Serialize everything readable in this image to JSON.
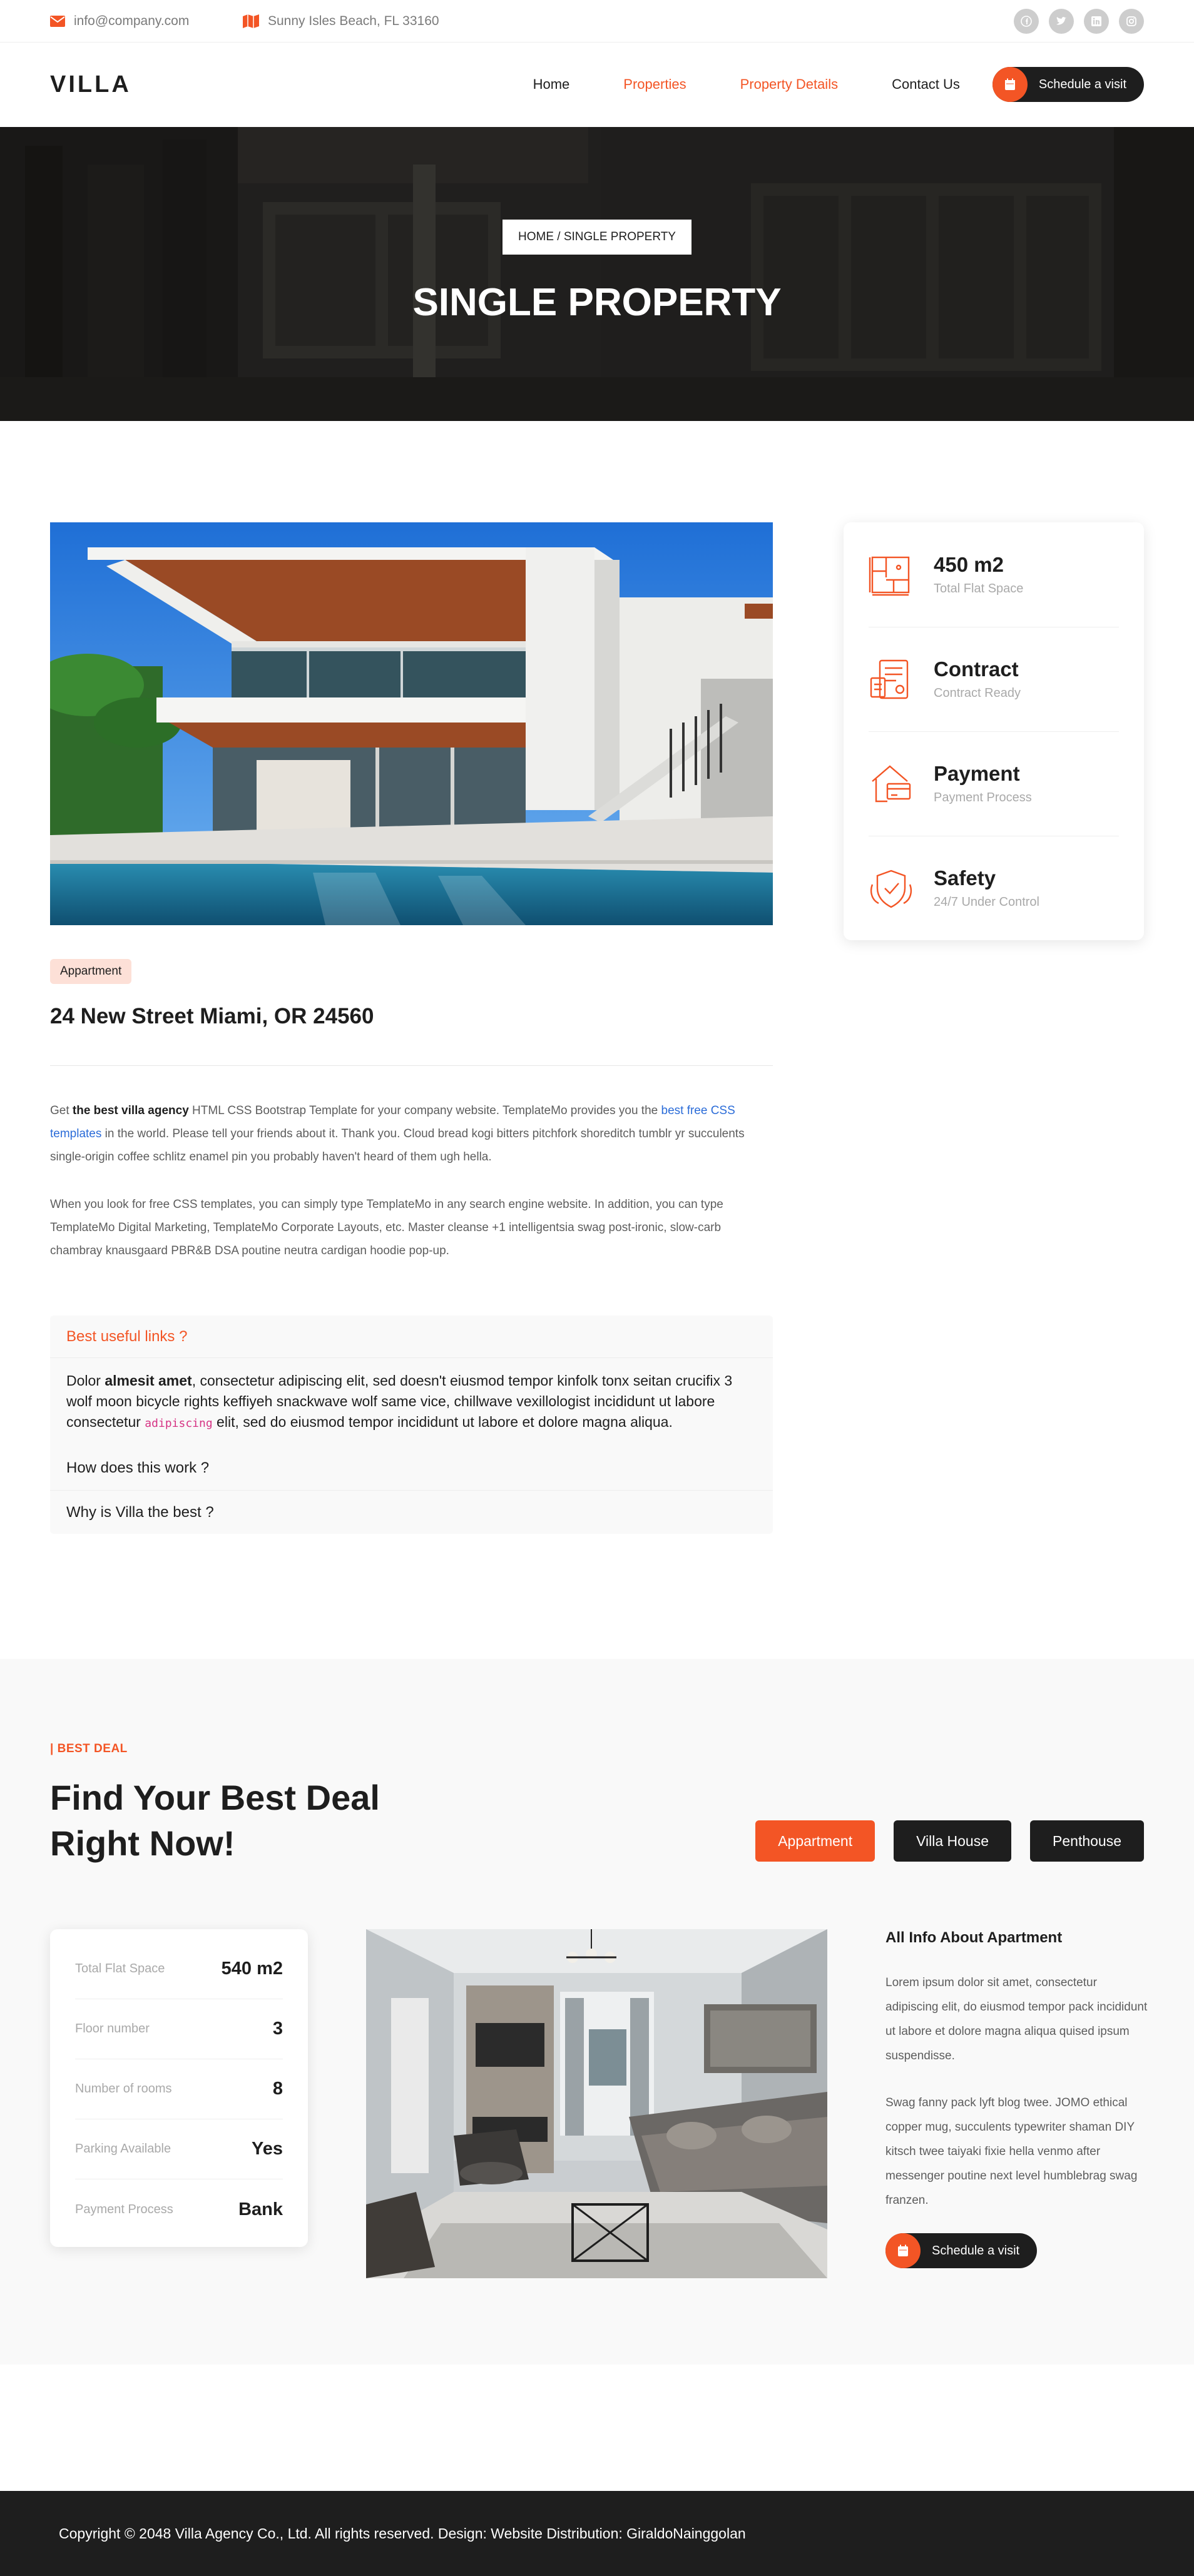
{
  "topbar": {
    "email": "info@company.com",
    "address": "Sunny Isles Beach, FL 33160",
    "socials": [
      "facebook-icon",
      "twitter-icon",
      "linkedin-icon",
      "instagram-icon"
    ]
  },
  "header": {
    "logo": "VILLA",
    "nav": [
      {
        "label": "Home",
        "active": false
      },
      {
        "label": "Properties",
        "active": true
      },
      {
        "label": "Property Details",
        "active": true
      },
      {
        "label": "Contact Us",
        "active": false
      }
    ],
    "cta": "Schedule a visit"
  },
  "hero": {
    "breadcrumb": "HOME / SINGLE PROPERTY",
    "title": "SINGLE PROPERTY"
  },
  "property": {
    "badge": "Appartment",
    "title": "24 New Street Miami, OR 24560",
    "para1": {
      "pre": "Get ",
      "bold": "the best villa agency",
      "mid": " HTML CSS Bootstrap Template for your company website. TemplateMo provides you the ",
      "link": "best free CSS templates",
      "post": " in the world. Please tell your friends about it. Thank you. Cloud bread kogi bitters pitchfork shoreditch tumblr yr succulents single-origin coffee schlitz enamel pin you probably haven't heard of them ugh hella."
    },
    "para2": "When you look for free CSS templates, you can simply type TemplateMo in any search engine website. In addition, you can type TemplateMo Digital Marketing, TemplateMo Corporate Layouts, etc. Master cleanse +1 intelligentsia swag post-ironic, slow-carb chambray knausgaard PBR&B DSA poutine neutra cardigan hoodie pop-up.",
    "accordion": {
      "open_title": "Best useful links ?",
      "body_pre": "Dolor ",
      "body_bold": "almesit amet",
      "body_mid": ", consectetur adipiscing elit, sed doesn't eiusmod tempor kinfolk tonx seitan crucifix 3 wolf moon bicycle rights keffiyeh snackwave wolf same vice, chillwave vexillologist incididunt ut labore consectetur ",
      "body_code": "adipiscing",
      "body_post": " elit, sed do eiusmod tempor incididunt ut labore et dolore magna aliqua.",
      "items": [
        "How does this work ?",
        "Why is Villa the best ?"
      ]
    }
  },
  "info_card": [
    {
      "title": "450 m2",
      "sub": "Total Flat Space"
    },
    {
      "title": "Contract",
      "sub": "Contract Ready"
    },
    {
      "title": "Payment",
      "sub": "Payment Process"
    },
    {
      "title": "Safety",
      "sub": "24/7 Under Control"
    }
  ],
  "deal": {
    "label": "| BEST DEAL",
    "title": "Find Your Best Deal Right Now!",
    "tabs": [
      {
        "label": "Appartment",
        "active": true
      },
      {
        "label": "Villa House",
        "active": false
      },
      {
        "label": "Penthouse",
        "active": false
      }
    ],
    "specs": [
      {
        "key": "Total Flat Space",
        "value": "540 m2"
      },
      {
        "key": "Floor number",
        "value": "3"
      },
      {
        "key": "Number of rooms",
        "value": "8"
      },
      {
        "key": "Parking Available",
        "value": "Yes"
      },
      {
        "key": "Payment Process",
        "value": "Bank"
      }
    ],
    "about_title": "All Info About Apartment",
    "about_p1": "Lorem ipsum dolor sit amet, consectetur adipiscing elit, do eiusmod tempor pack incididunt ut labore et dolore magna aliqua quised ipsum suspendisse.",
    "about_p2": "Swag fanny pack lyft blog twee. JOMO ethical copper mug, succulents typewriter shaman DIY kitsch twee taiyaki fixie hella venmo after messenger poutine next level humblebrag swag franzen.",
    "cta": "Schedule a visit"
  },
  "footer": {
    "text": "Copyright © 2048 Villa Agency Co., Ltd. All rights reserved. Design: Website Distribution: GiraldoNainggolan"
  },
  "colors": {
    "accent": "#f35525",
    "dark": "#1e1e1e",
    "muted": "#a9a9a9",
    "badge_bg": "#fde0d7"
  }
}
